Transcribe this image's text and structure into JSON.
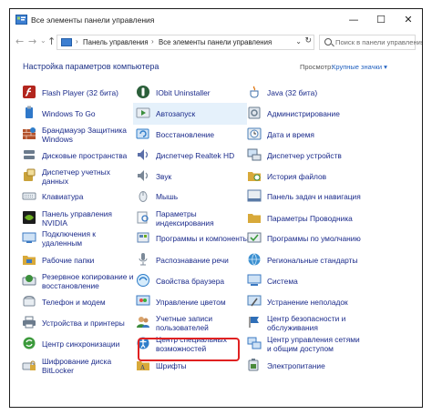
{
  "window": {
    "title": "Все элементы панели управления",
    "minimize": "—",
    "maximize": "☐",
    "close": "✕"
  },
  "address": {
    "back": "←",
    "forward": "→",
    "recent": "⌄",
    "up": "↑",
    "crumbs": [
      "Панель управления",
      "Все элементы панели управления"
    ],
    "separator": "›",
    "search_placeholder": "Поиск в панели управления"
  },
  "heading": "Настройка параметров компьютера",
  "view": {
    "label": "Просмотр:",
    "value": "Крупные значки ▾"
  },
  "items": [
    {
      "name": "flash-player",
      "label": "Flash Player (32 бита)",
      "icon": "flash-icon",
      "color": "#b3261e"
    },
    {
      "name": "iobit-uninstaller",
      "label": "IObit Uninstaller",
      "icon": "uninstaller-icon",
      "color": "#2b5f3a"
    },
    {
      "name": "java",
      "label": "Java (32 бита)",
      "icon": "java-icon",
      "color": "#e07b1a"
    },
    {
      "name": "windows-to-go",
      "label": "Windows To Go",
      "icon": "usb-drive-icon",
      "color": "#2f78c9"
    },
    {
      "name": "autoplay",
      "label": "Автозапуск",
      "icon": "autoplay-icon",
      "color": "#3c8f3c"
    },
    {
      "name": "administration",
      "label": "Администрирование",
      "icon": "admin-tools-icon",
      "color": "#6a7d8f"
    },
    {
      "name": "firewall",
      "label": "Брандмауэр Защитника Windows",
      "icon": "firewall-icon",
      "color": "#b2502a"
    },
    {
      "name": "recovery",
      "label": "Восстановление",
      "icon": "recovery-icon",
      "color": "#2f7dc9"
    },
    {
      "name": "date-time",
      "label": "Дата и время",
      "icon": "clock-icon",
      "color": "#4a7fb8"
    },
    {
      "name": "storage-spaces",
      "label": "Дисковые пространства",
      "icon": "storage-icon",
      "color": "#6b7b8c"
    },
    {
      "name": "realtek-hd",
      "label": "Диспетчер Realtek HD",
      "icon": "realtek-icon",
      "color": "#5b6fa8"
    },
    {
      "name": "device-manager",
      "label": "Диспетчер устройств",
      "icon": "device-manager-icon",
      "color": "#5c7087"
    },
    {
      "name": "credential-manager",
      "label": "Диспетчер учетных данных",
      "icon": "credential-icon",
      "color": "#c9a23a"
    },
    {
      "name": "sound",
      "label": "Звук",
      "icon": "speaker-icon",
      "color": "#7a8796"
    },
    {
      "name": "file-history",
      "label": "История файлов",
      "icon": "file-history-icon",
      "color": "#d8a93a"
    },
    {
      "name": "keyboard",
      "label": "Клавиатура",
      "icon": "keyboard-icon",
      "color": "#7c8a99"
    },
    {
      "name": "mouse",
      "label": "Мышь",
      "icon": "mouse-icon",
      "color": "#8a96a3"
    },
    {
      "name": "taskbar",
      "label": "Панель задач и навигация",
      "icon": "taskbar-icon",
      "color": "#5a7aa6"
    },
    {
      "name": "nvidia",
      "label": "Панель управления NVIDIA",
      "icon": "nvidia-icon",
      "color": "#6cae22"
    },
    {
      "name": "indexing",
      "label": "Параметры индексирования",
      "icon": "indexing-icon",
      "color": "#8a97a6"
    },
    {
      "name": "explorer-options",
      "label": "Параметры Проводника",
      "icon": "folder-options-icon",
      "color": "#d8a93a"
    },
    {
      "name": "remoteapp",
      "label": "Подключения к удаленным",
      "icon": "remoteapp-icon",
      "color": "#3b79c2"
    },
    {
      "name": "programs-features",
      "label": "Программы и компоненты",
      "icon": "programs-icon",
      "color": "#5a82b5"
    },
    {
      "name": "default-programs",
      "label": "Программы по умолчанию",
      "icon": "default-programs-icon",
      "color": "#3b9a3b"
    },
    {
      "name": "work-folders",
      "label": "Рабочие папки",
      "icon": "work-folders-icon",
      "color": "#d8a93a"
    },
    {
      "name": "speech-recognition",
      "label": "Распознавание речи",
      "icon": "microphone-icon",
      "color": "#7c8a99"
    },
    {
      "name": "region",
      "label": "Региональные стандарты",
      "icon": "globe-icon",
      "color": "#3b8fd0"
    },
    {
      "name": "backup-restore",
      "label": "Резервное копирование и восстановление",
      "icon": "backup-icon",
      "color": "#3c8f3c"
    },
    {
      "name": "internet-options",
      "label": "Свойства браузера",
      "icon": "internet-icon",
      "color": "#2f7dc9"
    },
    {
      "name": "system",
      "label": "Система",
      "icon": "system-icon",
      "color": "#3b79c2"
    },
    {
      "name": "phone-modem",
      "label": "Телефон и модем",
      "icon": "phone-icon",
      "color": "#7c8a99"
    },
    {
      "name": "color-management",
      "label": "Управление цветом",
      "icon": "color-management-icon",
      "color": "#3b79c2"
    },
    {
      "name": "troubleshooting",
      "label": "Устранение неполадок",
      "icon": "troubleshoot-icon",
      "color": "#4a7fb8"
    },
    {
      "name": "devices-printers",
      "label": "Устройства и принтеры",
      "icon": "printer-icon",
      "color": "#6b7b8c"
    },
    {
      "name": "user-accounts",
      "label": "Учетные записи пользователей",
      "icon": "user-accounts-icon",
      "color": "#3b8a3b"
    },
    {
      "name": "security-maintenance",
      "label": "Центр безопасности и обслуживания",
      "icon": "flag-icon",
      "color": "#2f6fb8"
    },
    {
      "name": "sync-center",
      "label": "Центр синхронизации",
      "icon": "sync-icon",
      "color": "#3c9a3c"
    },
    {
      "name": "ease-of-access",
      "label": "Центр специальных возможностей",
      "icon": "accessibility-icon",
      "color": "#2f7dc9"
    },
    {
      "name": "network-sharing",
      "label": "Центр управления сетями и общим доступом",
      "icon": "network-icon",
      "color": "#3b79c2"
    },
    {
      "name": "bitlocker",
      "label": "Шифрование диска BitLocker",
      "icon": "bitlocker-icon",
      "color": "#7c8a99"
    },
    {
      "name": "fonts",
      "label": "Шрифты",
      "icon": "fonts-icon",
      "color": "#d8a93a"
    },
    {
      "name": "power-options",
      "label": "Электропитание",
      "icon": "power-icon",
      "color": "#4a8a3a"
    }
  ],
  "selected_item": "autoplay",
  "highlighted_item": "user-accounts",
  "colors": {
    "link": "#1a2a8a",
    "heading": "#1e3287",
    "selection": "#e5f1fb",
    "highlight_border": "#e02121"
  }
}
